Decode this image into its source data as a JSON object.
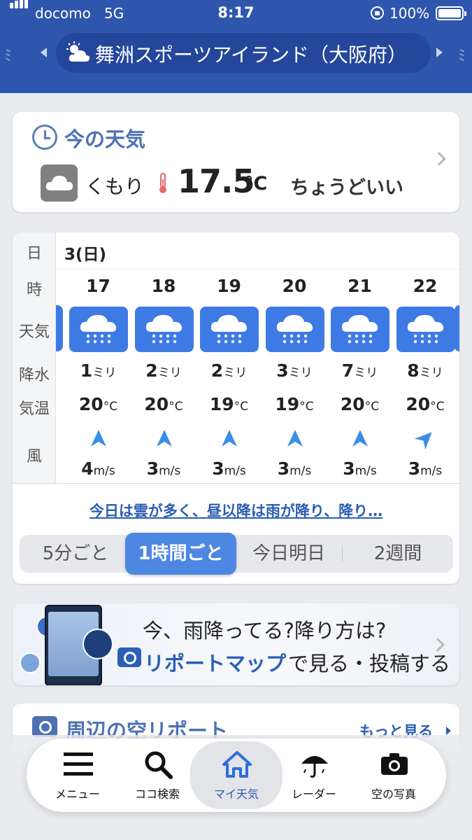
{
  "status_bar": {
    "carrier": "docomo",
    "network": "5G",
    "time": "8:17",
    "battery": "100%"
  },
  "header": {
    "location": "舞洲スポーツアイランド（大阪府）",
    "location_icon": "partly-cloudy-icon",
    "prev_mark": "ﾐ",
    "next_mark": "ﾐ"
  },
  "current": {
    "title": "今の天気",
    "condition": "くもり",
    "temperature": "17.5",
    "unit": "°C",
    "feel": "ちょうどいい"
  },
  "forecast": {
    "labels": {
      "day": "日",
      "hour": "時",
      "weather": "天気",
      "precip": "降水",
      "temp": "気温",
      "wind": "風"
    },
    "date": "3(日)",
    "precip_unit": "ミリ",
    "temp_unit": "°C",
    "wind_unit": "m/s",
    "hours": [
      {
        "hour": "17",
        "weather": "rain",
        "precip": "1",
        "temp": "20",
        "wind_dir": "N",
        "wind": "4"
      },
      {
        "hour": "18",
        "weather": "rain",
        "precip": "2",
        "temp": "20",
        "wind_dir": "N",
        "wind": "3"
      },
      {
        "hour": "19",
        "weather": "rain",
        "precip": "2",
        "temp": "19",
        "wind_dir": "N",
        "wind": "3"
      },
      {
        "hour": "20",
        "weather": "rain",
        "precip": "3",
        "temp": "19",
        "wind_dir": "N",
        "wind": "3"
      },
      {
        "hour": "21",
        "weather": "rain",
        "precip": "7",
        "temp": "20",
        "wind_dir": "N",
        "wind": "3"
      },
      {
        "hour": "22",
        "weather": "rain",
        "precip": "8",
        "temp": "20",
        "wind_dir": "NE",
        "wind": "3"
      }
    ],
    "summary": "今日は雲が多く、昼以降は雨が降り、降り…",
    "tabs": [
      "5分ごと",
      "1時間ごと",
      "今日明日",
      "2週間"
    ],
    "active_tab": 1
  },
  "banner": {
    "line1": "今、雨降ってる?降り方は?",
    "line2_strong": "リポートマップ",
    "line2_rest": "で見る・投稿する"
  },
  "nearby": {
    "title": "周辺の空リポート",
    "more": "もっと見る"
  },
  "nav": [
    {
      "label": "メニュー",
      "icon": "menu-icon"
    },
    {
      "label": "ココ検索",
      "icon": "search-icon"
    },
    {
      "label": "マイ天気",
      "icon": "home-icon"
    },
    {
      "label": "レーダー",
      "icon": "umbrella-icon"
    },
    {
      "label": "空の写真",
      "icon": "camera-icon"
    }
  ],
  "colors": {
    "header_blue": "#2f56ad",
    "accent_blue": "#3e7ae4",
    "link_blue": "#2a5db3"
  }
}
